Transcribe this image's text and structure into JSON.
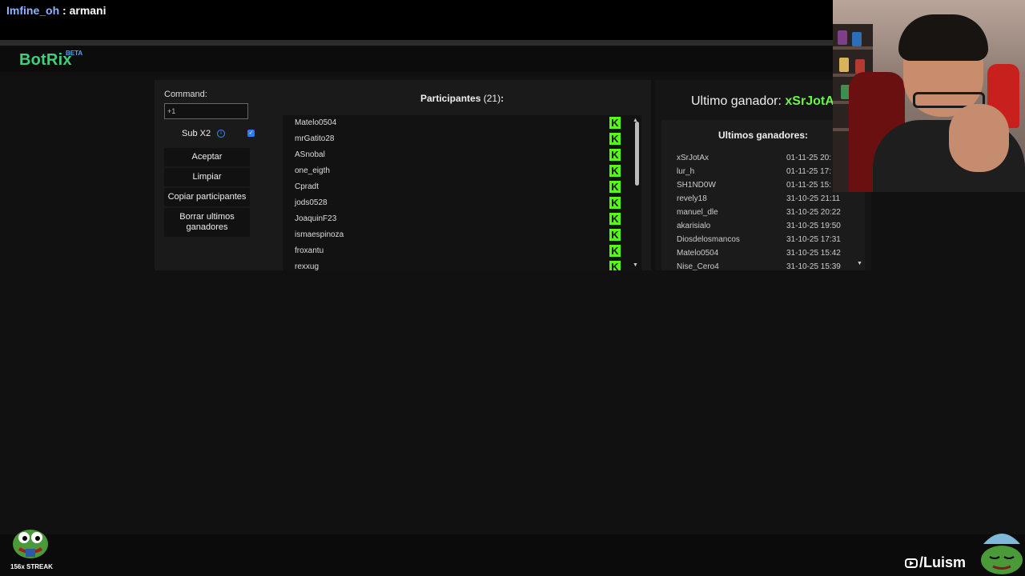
{
  "chat": {
    "username": "Imfine_oh",
    "separator": " : ",
    "message": "armani"
  },
  "app": {
    "logo": "BotRix",
    "badge": "BETA"
  },
  "controls": {
    "command_label": "Command:",
    "command_value": "+1",
    "subx2_label": "Sub X2",
    "subx2_checked": true,
    "buttons": [
      "Aceptar",
      "Limpiar",
      "Copiar participantes",
      "Borrar ultimos ganadores"
    ]
  },
  "participants": {
    "title": "Participantes",
    "count": "(21)",
    "colon": ":",
    "platform_icon": "kick-icon",
    "platform_color": "#53fc18",
    "items": [
      "Matelo0504",
      "mrGatito28",
      "ASnobal",
      "one_eigth",
      "Cpradt",
      "jods0528",
      "JoaquinF23",
      "ismaespinoza",
      "froxantu",
      "rexxug"
    ]
  },
  "winner": {
    "label": "Ultimo ganador:",
    "name": "xSrJotAx"
  },
  "history": {
    "title": "Ultimos ganadores:",
    "rows": [
      {
        "user": "xSrJotAx",
        "date": "01-11-25 20:"
      },
      {
        "user": "lur_h",
        "date": "01-11-25 17:"
      },
      {
        "user": "SH1ND0W",
        "date": "01-11-25 15:"
      },
      {
        "user": "revely18",
        "date": "31-10-25 21:11"
      },
      {
        "user": "manuel_dle",
        "date": "31-10-25 20:22"
      },
      {
        "user": "akarisialo",
        "date": "31-10-25 19:50"
      },
      {
        "user": "Diosdelosmancos",
        "date": "31-10-25 17:31"
      },
      {
        "user": "Matelo0504",
        "date": "31-10-25 15:42"
      },
      {
        "user": "Nise_Cero4",
        "date": "31-10-25 15:39"
      }
    ]
  },
  "overlay": {
    "streak": "156x STREAK",
    "youtube": "/Luism"
  },
  "colors": {
    "accent_green": "#3ed07a",
    "winner_green": "#6cf545",
    "checkbox_blue": "#2a7cff"
  }
}
